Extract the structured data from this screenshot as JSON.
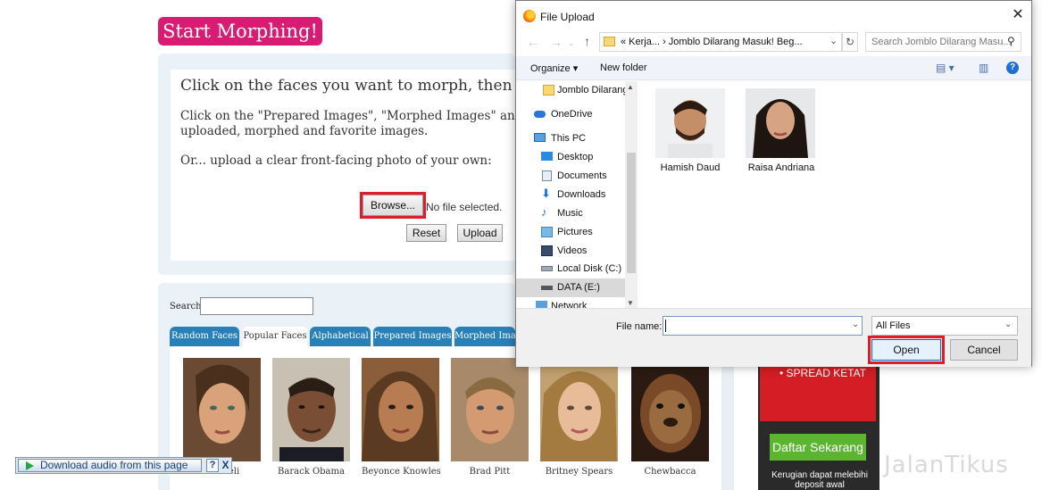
{
  "page": {
    "start_button": "Start Morphing!",
    "intro_heading": "Click on the faces you want to morph, then click t",
    "intro_text": "Click on the \"Prepared Images\", \"Morphed Images\" and \"Favo uploaded, morphed and favorite images.",
    "upload_prompt": "Or... upload a clear front-facing photo of your own:",
    "browse_label": "Browse...",
    "no_file_text": "No file selected.",
    "reset_label": "Reset",
    "upload_label": "Upload",
    "search_label": "Search:",
    "tabs": [
      {
        "label": "Random Faces",
        "active": false
      },
      {
        "label": "Popular Faces",
        "active": true
      },
      {
        "label": "Alphabetical",
        "active": false
      },
      {
        "label": "Prepared Images",
        "active": false
      },
      {
        "label": "Morphed Imag",
        "active": false
      }
    ],
    "faces": [
      {
        "name": "eli"
      },
      {
        "name": "Barack Obama"
      },
      {
        "name": "Beyonce Knowles"
      },
      {
        "name": "Brad Pitt"
      },
      {
        "name": "Britney Spears"
      },
      {
        "name": "Chewbacca"
      }
    ],
    "ad": {
      "headline": "• SPREAD KETAT",
      "cta": "Daftar Sekarang",
      "disclaimer": "Kerugian dapat melebihi deposit awal"
    },
    "watermark": "JalanTikus",
    "download_bar": {
      "link": "Download audio from this page",
      "help": "?",
      "close": "X"
    }
  },
  "dialog": {
    "title": "File Upload",
    "close": "✕",
    "address": "«  Kerja...  ›  Jomblo Dilarang Masuk! Beg...",
    "search_placeholder": "Search Jomblo Dilarang Masu...",
    "toolbar": {
      "organize": "Organize ▾",
      "new_folder": "New folder"
    },
    "nav_items": [
      {
        "label": "Jomblo Dilarang",
        "icon": "folder-icon"
      },
      {
        "label": "OneDrive",
        "icon": "cloud-icon"
      },
      {
        "label": "This PC",
        "icon": "computer-icon"
      },
      {
        "label": "Desktop",
        "icon": "desktop-icon"
      },
      {
        "label": "Documents",
        "icon": "documents-icon"
      },
      {
        "label": "Downloads",
        "icon": "downloads-icon"
      },
      {
        "label": "Music",
        "icon": "music-icon"
      },
      {
        "label": "Pictures",
        "icon": "pictures-icon"
      },
      {
        "label": "Videos",
        "icon": "videos-icon"
      },
      {
        "label": "Local Disk (C:)",
        "icon": "drive-icon"
      },
      {
        "label": "DATA (E:)",
        "icon": "drive-icon",
        "selected": true
      },
      {
        "label": "Network",
        "icon": "network-icon"
      }
    ],
    "files": [
      {
        "name": "Hamish Daud"
      },
      {
        "name": "Raisa Andriana"
      }
    ],
    "file_name_label": "File name:",
    "file_name_value": "",
    "file_type": "All Files",
    "open_label": "Open",
    "cancel_label": "Cancel"
  },
  "colors": {
    "accent_pink": "#d81b73",
    "tab_blue": "#2980b9",
    "highlight_red": "#e01b2a",
    "ad_red": "#d41d24",
    "ad_green": "#5cb531"
  }
}
